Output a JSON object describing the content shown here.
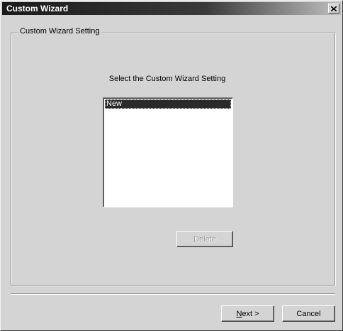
{
  "window": {
    "title": "Custom Wizard",
    "close_icon": "close-icon"
  },
  "groupbox": {
    "label": "Custom Wizard Setting"
  },
  "main": {
    "prompt": "Select the Custom Wizard Setting",
    "list_items": [
      "New"
    ],
    "selected_index": 0,
    "delete_label": "Delete"
  },
  "footer": {
    "next_mnemonic": "N",
    "next_rest": "ext >",
    "cancel_label": "Cancel"
  }
}
